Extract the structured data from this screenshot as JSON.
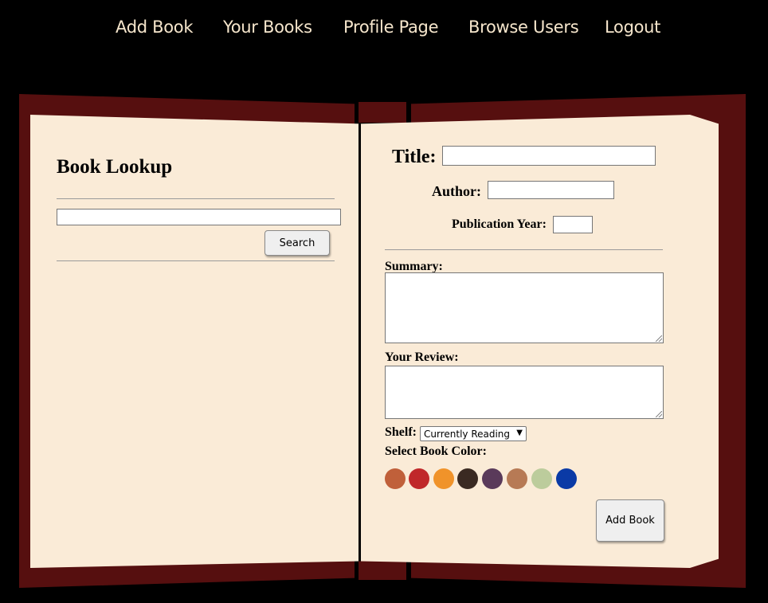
{
  "nav": {
    "items": [
      "Add Book",
      "Your Books",
      "Profile Page",
      "Browse Users",
      "Logout"
    ]
  },
  "left_page": {
    "title": "Book Lookup",
    "search_input_value": "",
    "search_button": "Search"
  },
  "right_page": {
    "title_label": "Title:",
    "author_label": "Author:",
    "pub_year_label": "Publication Year:",
    "summary_label": "Summary:",
    "review_label": "Your Review:",
    "shelf_label": "Shelf:",
    "shelf_selected": "Currently Reading",
    "color_label": "Select Book Color:",
    "colors": [
      "#c0603a",
      "#c0282a",
      "#f0932a",
      "#3a2a22",
      "#5a3a5a",
      "#b77a55",
      "#bccc9c",
      "#0a3aa6"
    ],
    "submit_button": "Add Book"
  },
  "theme": {
    "background": "#000000",
    "cover": "#560f0f",
    "page": "#faebd7",
    "nav_text": "#f6e6cc"
  }
}
